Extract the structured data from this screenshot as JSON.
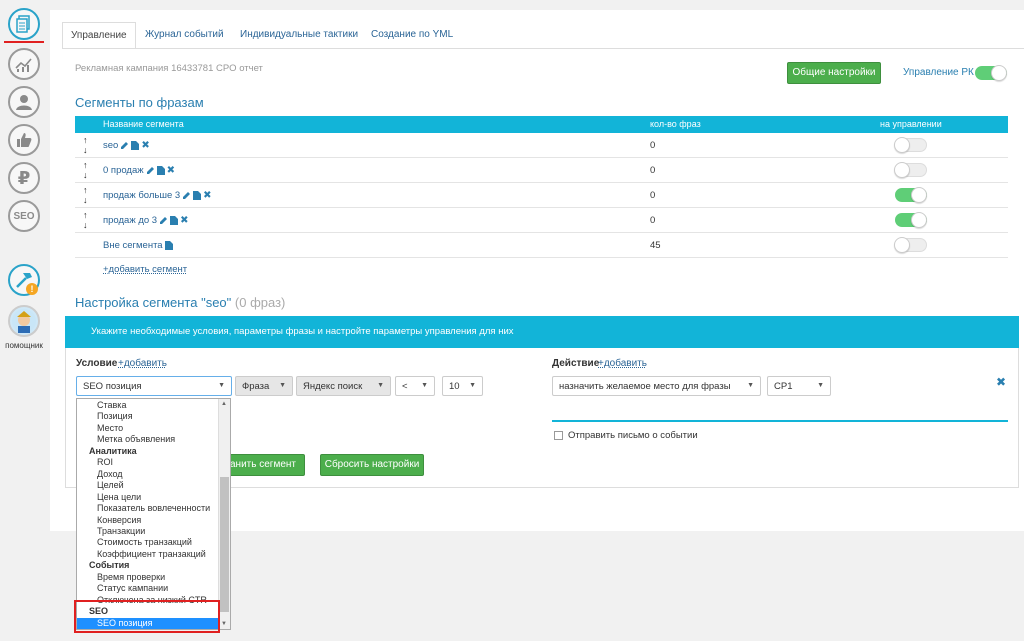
{
  "sidebar": {
    "icons": [
      "document-icon",
      "chart-icon",
      "user-icon",
      "thumbs-up-icon",
      "ruble-icon",
      "seo-icon",
      "hammer-icon",
      "assistant-avatar"
    ],
    "seo_label": "SEO",
    "ruble_label": "₽",
    "assistant_label": "помощник"
  },
  "tabs": [
    "Управление",
    "Журнал событий",
    "Индивидуальные тактики",
    "Создание по YML"
  ],
  "header": {
    "campaign": "Рекламная кампания 16433781 CPO отчет",
    "settings_button": "Общие настройки",
    "rk_label": "Управление РК"
  },
  "segments": {
    "title": "Сегменты по фразам",
    "columns": [
      "Название сегмента",
      "кол-во фраз",
      "на управлении"
    ],
    "rows": [
      {
        "name": "seo",
        "count": "0",
        "on": false,
        "movable": true,
        "edit": true
      },
      {
        "name": "0 продаж",
        "count": "0",
        "on": false,
        "movable": true,
        "edit": true
      },
      {
        "name": "продаж больше 3",
        "count": "0",
        "on": true,
        "movable": true,
        "edit": true
      },
      {
        "name": "продаж до 3",
        "count": "0",
        "on": true,
        "movable": true,
        "edit": true
      },
      {
        "name": "Вне сегмента",
        "count": "45",
        "on": false,
        "movable": false,
        "edit": false
      }
    ],
    "add_link": "+добавить сегмент"
  },
  "segment_settings": {
    "title": "Настройка сегмента \"seo\"",
    "title_suffix": "(0 фраз)",
    "banner": "Укажите необходимые условия, параметры фразы и настройте параметры управления для них",
    "condition_label": "Условие",
    "condition_add": "+добавить",
    "action_label": "Действие",
    "action_add": "+добавить",
    "condition_select": "SEO позиция",
    "phrase_select": "Фраза",
    "engine_select": "Яндекс поиск",
    "operator_select": "<",
    "value_select": "10",
    "action_select": "назначить желаемое место для фразы",
    "place_select": "СР1",
    "email_checkbox": "Отправить письмо о событии",
    "save_button": "Сохранить сегмент",
    "save_button_visible": "ранить сегмент",
    "reset_button": "Сбросить настройки"
  },
  "dropdown": {
    "items": [
      {
        "type": "opt",
        "label": "Ставка"
      },
      {
        "type": "opt",
        "label": "Позиция"
      },
      {
        "type": "opt",
        "label": "Место"
      },
      {
        "type": "opt",
        "label": "Метка объявления"
      },
      {
        "type": "grp",
        "label": "Аналитика"
      },
      {
        "type": "opt",
        "label": "ROI"
      },
      {
        "type": "opt",
        "label": "Доход"
      },
      {
        "type": "opt",
        "label": "Целей"
      },
      {
        "type": "opt",
        "label": "Цена цели"
      },
      {
        "type": "opt",
        "label": "Показатель вовлеченности"
      },
      {
        "type": "opt",
        "label": "Конверсия"
      },
      {
        "type": "opt",
        "label": "Транзакции"
      },
      {
        "type": "opt",
        "label": "Стоимость транзакций"
      },
      {
        "type": "opt",
        "label": "Коэффициент транзакций"
      },
      {
        "type": "grp",
        "label": "События"
      },
      {
        "type": "opt",
        "label": "Время проверки"
      },
      {
        "type": "opt",
        "label": "Статус кампании"
      },
      {
        "type": "opt",
        "label": "Отключена за низкий CTR"
      },
      {
        "type": "grp",
        "label": "SEO"
      },
      {
        "type": "sel",
        "label": "SEO позиция"
      }
    ]
  },
  "colors": {
    "accent": "#12b4d8",
    "green": "#4cae4c",
    "toggle_on": "#5fce77",
    "highlight": "#e02020"
  }
}
